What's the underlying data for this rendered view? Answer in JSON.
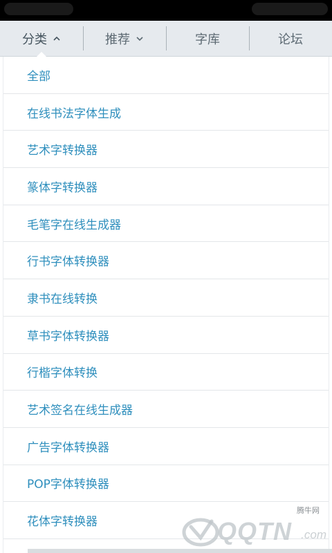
{
  "tabs": [
    {
      "label": "分类",
      "chevron": "chevron-up-icon",
      "active": true
    },
    {
      "label": "推荐",
      "chevron": "chevron-down-icon",
      "active": false
    },
    {
      "label": "字库",
      "active": false
    },
    {
      "label": "论坛",
      "active": false
    }
  ],
  "menu": {
    "items": [
      "全部",
      "在线书法字体生成",
      "艺术字转换器",
      "篆体字转换器",
      "毛笔字在线生成器",
      "行书字体转换器",
      "隶书在线转换",
      "草书字体转换器",
      "行楷字体转换",
      "艺术签名在线生成器",
      "广告字体转换器",
      "POP字体转换器",
      "花体字转换器"
    ]
  },
  "watermark": {
    "site": "腾牛网",
    "brand": "QQTN",
    "suffix": ".com"
  },
  "colors": {
    "tabbar_bg": "#e6eaee",
    "tab_text": "#5d6a73",
    "menu_text": "#2f8fbd",
    "divider": "#e3e6e9"
  }
}
